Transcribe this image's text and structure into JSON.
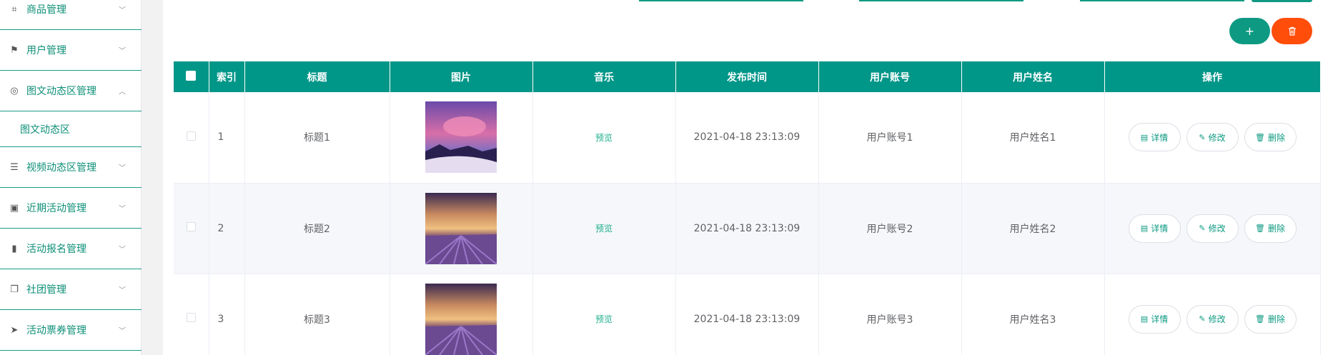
{
  "sidebar": {
    "items": [
      {
        "label": "商品管理",
        "icon": "crop-icon",
        "glyph": "⌗"
      },
      {
        "label": "用户管理",
        "icon": "flag-icon",
        "glyph": "⚑"
      },
      {
        "label": "图文动态区管理",
        "icon": "compass-icon",
        "glyph": "◎",
        "expanded": true
      },
      {
        "label": "视频动态区管理",
        "icon": "sliders-icon",
        "glyph": "☰"
      },
      {
        "label": "近期活动管理",
        "icon": "clipboard-icon",
        "glyph": "▣"
      },
      {
        "label": "活动报名管理",
        "icon": "bar-chart-icon",
        "glyph": "▮"
      },
      {
        "label": "社团管理",
        "icon": "copy-icon",
        "glyph": "❐"
      },
      {
        "label": "活动票券管理",
        "icon": "send-icon",
        "glyph": "➤"
      }
    ],
    "subitem": "图文动态区"
  },
  "toolbar": {
    "add_glyph": "+",
    "delete_glyph": "🗑"
  },
  "table": {
    "headers": [
      "索引",
      "标题",
      "图片",
      "音乐",
      "发布时间",
      "用户账号",
      "用户姓名",
      "操作"
    ],
    "rows": [
      {
        "index": "1",
        "title": "标题1",
        "music": "预览",
        "time": "2021-04-18 23:13:09",
        "account": "用户账号1",
        "name": "用户姓名1"
      },
      {
        "index": "2",
        "title": "标题2",
        "music": "预览",
        "time": "2021-04-18 23:13:09",
        "account": "用户账号2",
        "name": "用户姓名2"
      },
      {
        "index": "3",
        "title": "标题3",
        "music": "预览",
        "time": "2021-04-18 23:13:09",
        "account": "用户账号3",
        "name": "用户姓名3"
      }
    ],
    "actions": {
      "detail": "详情",
      "edit": "修改",
      "delete": "删除"
    }
  },
  "colors": {
    "primary": "#009688",
    "danger": "#ff4d0a",
    "accent_text": "#0e8f77"
  }
}
